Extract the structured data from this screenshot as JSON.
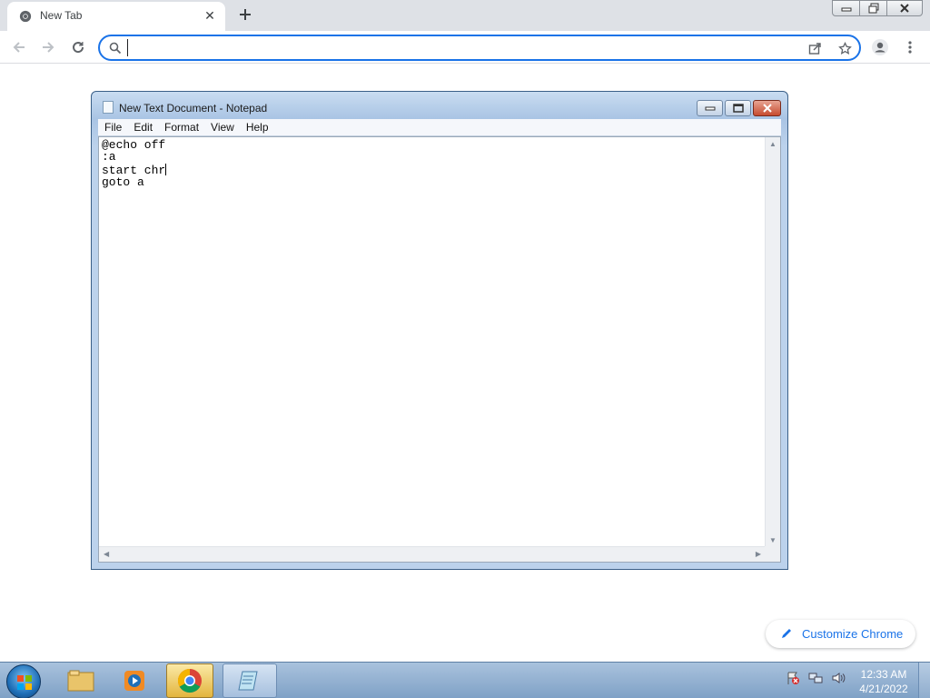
{
  "browser": {
    "tab": {
      "title": "New Tab",
      "favicon": "chrome-icon",
      "close_icon": "close-icon"
    },
    "new_tab_icon": "plus-icon",
    "window_controls": [
      "minimize-icon",
      "restore-icon",
      "close-icon"
    ],
    "omnibox": {
      "value": "",
      "placeholder": ""
    },
    "customize_label": "Customize Chrome",
    "accent": "#1a73e8"
  },
  "notepad": {
    "title": "New Text Document - Notepad",
    "menu": [
      "File",
      "Edit",
      "Format",
      "View",
      "Help"
    ],
    "lines": [
      "@echo off",
      ":a",
      "start chr",
      "goto a"
    ]
  },
  "taskbar": {
    "clock_time": "12:33 AM",
    "clock_date": "4/21/2022",
    "apps": [
      "folder-icon",
      "media-player-icon",
      "chrome-icon",
      "notepad-icon"
    ]
  }
}
